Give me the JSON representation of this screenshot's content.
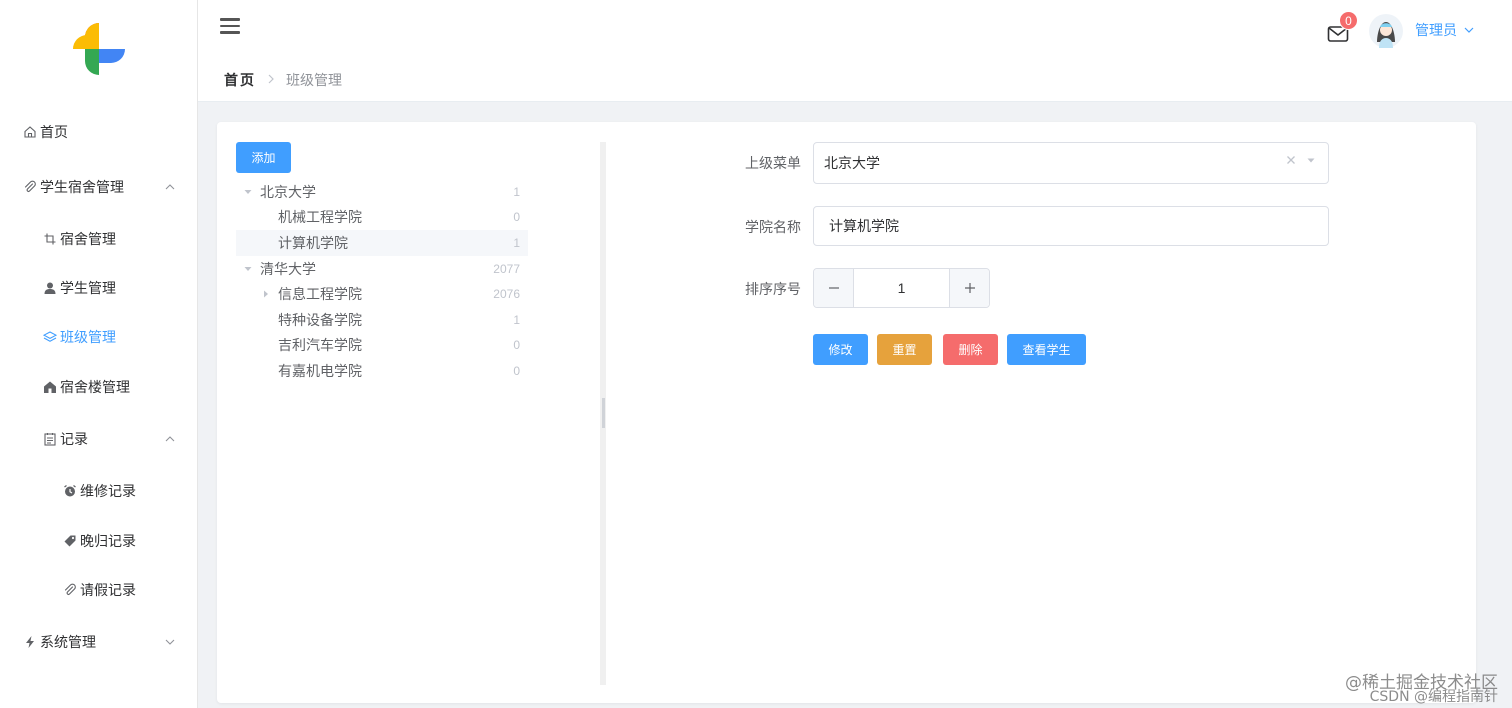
{
  "sidebar": {
    "items": [
      {
        "label": "首页",
        "icon": "home-icon"
      },
      {
        "label": "学生宿舍管理",
        "icon": "paperclip-icon",
        "expanded": true
      },
      {
        "label": "宿舍管理",
        "icon": "crop-icon"
      },
      {
        "label": "学生管理",
        "icon": "user-icon"
      },
      {
        "label": "班级管理",
        "icon": "layers-icon",
        "active": true
      },
      {
        "label": "宿舍楼管理",
        "icon": "house-icon"
      },
      {
        "label": "记录",
        "icon": "document-icon",
        "expanded": true
      },
      {
        "label": "维修记录",
        "icon": "alarm-clock-icon"
      },
      {
        "label": "晚归记录",
        "icon": "price-tag-icon"
      },
      {
        "label": "请假记录",
        "icon": "paperclip-icon"
      },
      {
        "label": "系统管理",
        "icon": "lightning-icon",
        "expanded": false
      }
    ]
  },
  "header": {
    "notification_count": "0",
    "username": "管理员"
  },
  "breadcrumb": {
    "home": "首页",
    "current": "班级管理"
  },
  "tree": {
    "add_label": "添加",
    "nodes": [
      {
        "label": "北京大学",
        "count": "1",
        "level": 0,
        "expanded": true
      },
      {
        "label": "机械工程学院",
        "count": "0",
        "level": 1
      },
      {
        "label": "计算机学院",
        "count": "1",
        "level": 1,
        "selected": true
      },
      {
        "label": "清华大学",
        "count": "2077",
        "level": 0,
        "expanded": true
      },
      {
        "label": "信息工程学院",
        "count": "2076",
        "level": 1,
        "collapsed": true
      },
      {
        "label": "特种设备学院",
        "count": "1",
        "level": 1
      },
      {
        "label": "吉利汽车学院",
        "count": "0",
        "level": 1
      },
      {
        "label": "有嘉机电学院",
        "count": "0",
        "level": 1
      }
    ]
  },
  "form": {
    "parent_label": "上级菜单",
    "parent_value": "北京大学",
    "name_label": "学院名称",
    "name_value": "计算机学院",
    "sort_label": "排序序号",
    "sort_value": "1",
    "edit_label": "修改",
    "reset_label": "重置",
    "delete_label": "删除",
    "view_label": "查看学生"
  },
  "watermark": {
    "line1": "@稀土掘金技术社区",
    "line2": "CSDN @编程指南针"
  },
  "colors": {
    "primary": "#409eff",
    "warning": "#e6a23c",
    "danger": "#f56c6c"
  }
}
